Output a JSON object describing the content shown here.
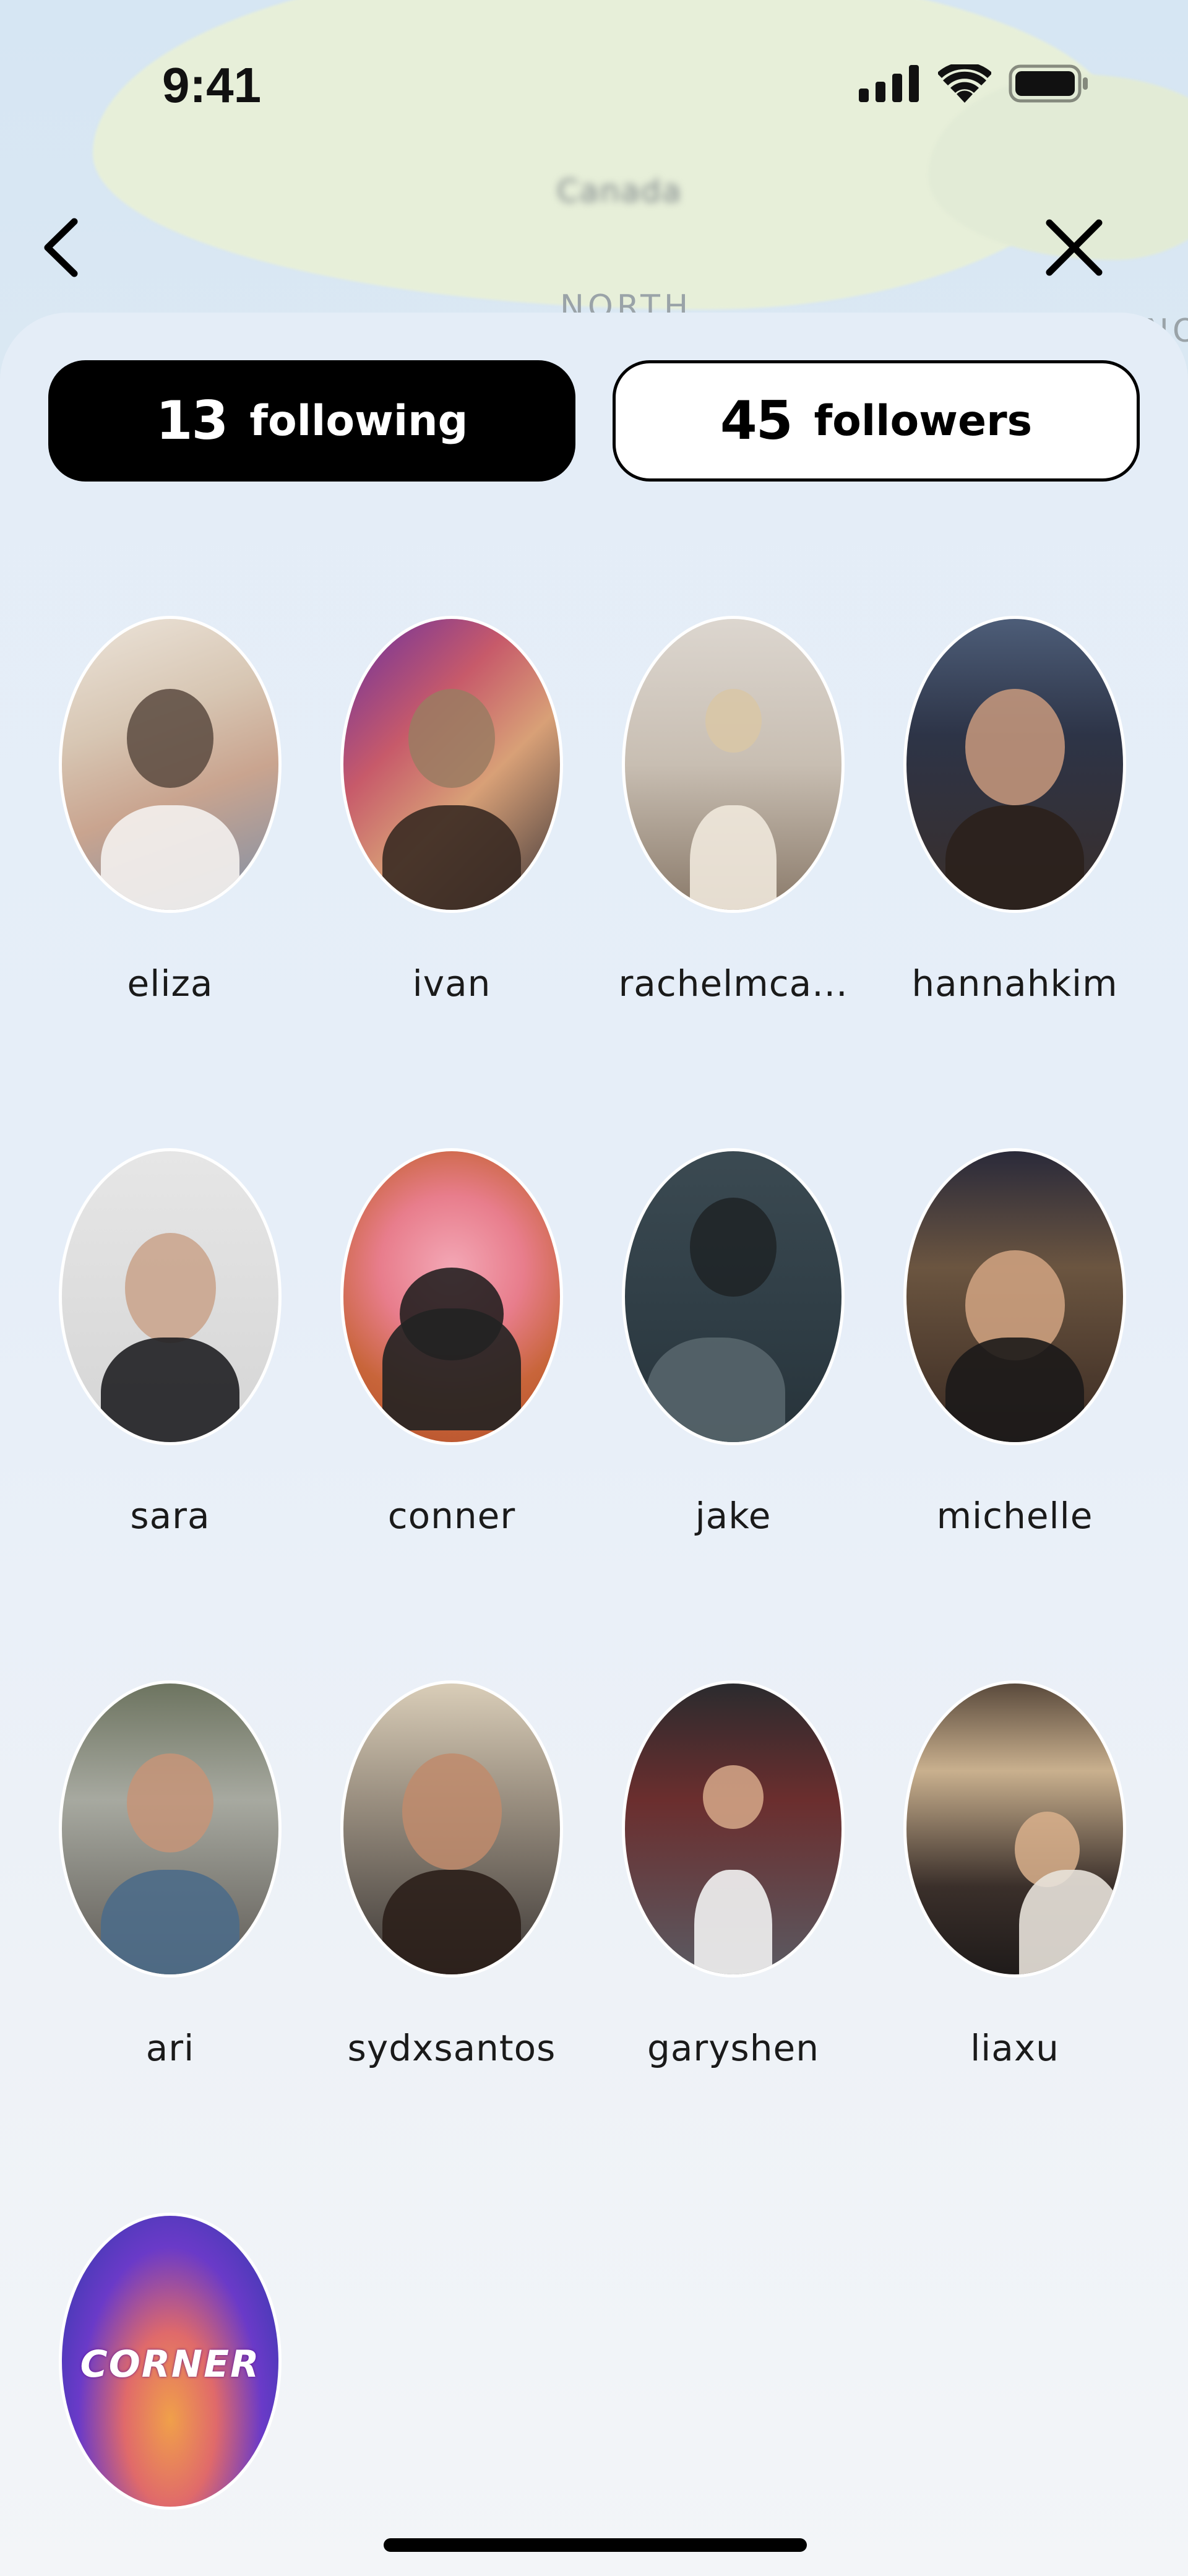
{
  "status_bar": {
    "time": "9:41"
  },
  "map": {
    "label_country": "Canada",
    "label_region": "NORTH",
    "label_edge": "NO"
  },
  "tabs": {
    "following": {
      "count": "13",
      "label": "following"
    },
    "followers": {
      "count": "45",
      "label": "followers"
    }
  },
  "people": [
    {
      "name": "eliza"
    },
    {
      "name": "ivan"
    },
    {
      "name": "rachelmca..."
    },
    {
      "name": "hannahkim"
    },
    {
      "name": "sara"
    },
    {
      "name": "conner"
    },
    {
      "name": "jake"
    },
    {
      "name": "michelle"
    },
    {
      "name": "ari"
    },
    {
      "name": "sydxsantos"
    },
    {
      "name": "garyshen"
    },
    {
      "name": "liaxu"
    },
    {
      "name": "",
      "avatar_text": "CORNER"
    }
  ],
  "colors": {
    "accent": "#000000",
    "sheet": "#e6eef8",
    "text": "#1a1a1a"
  }
}
